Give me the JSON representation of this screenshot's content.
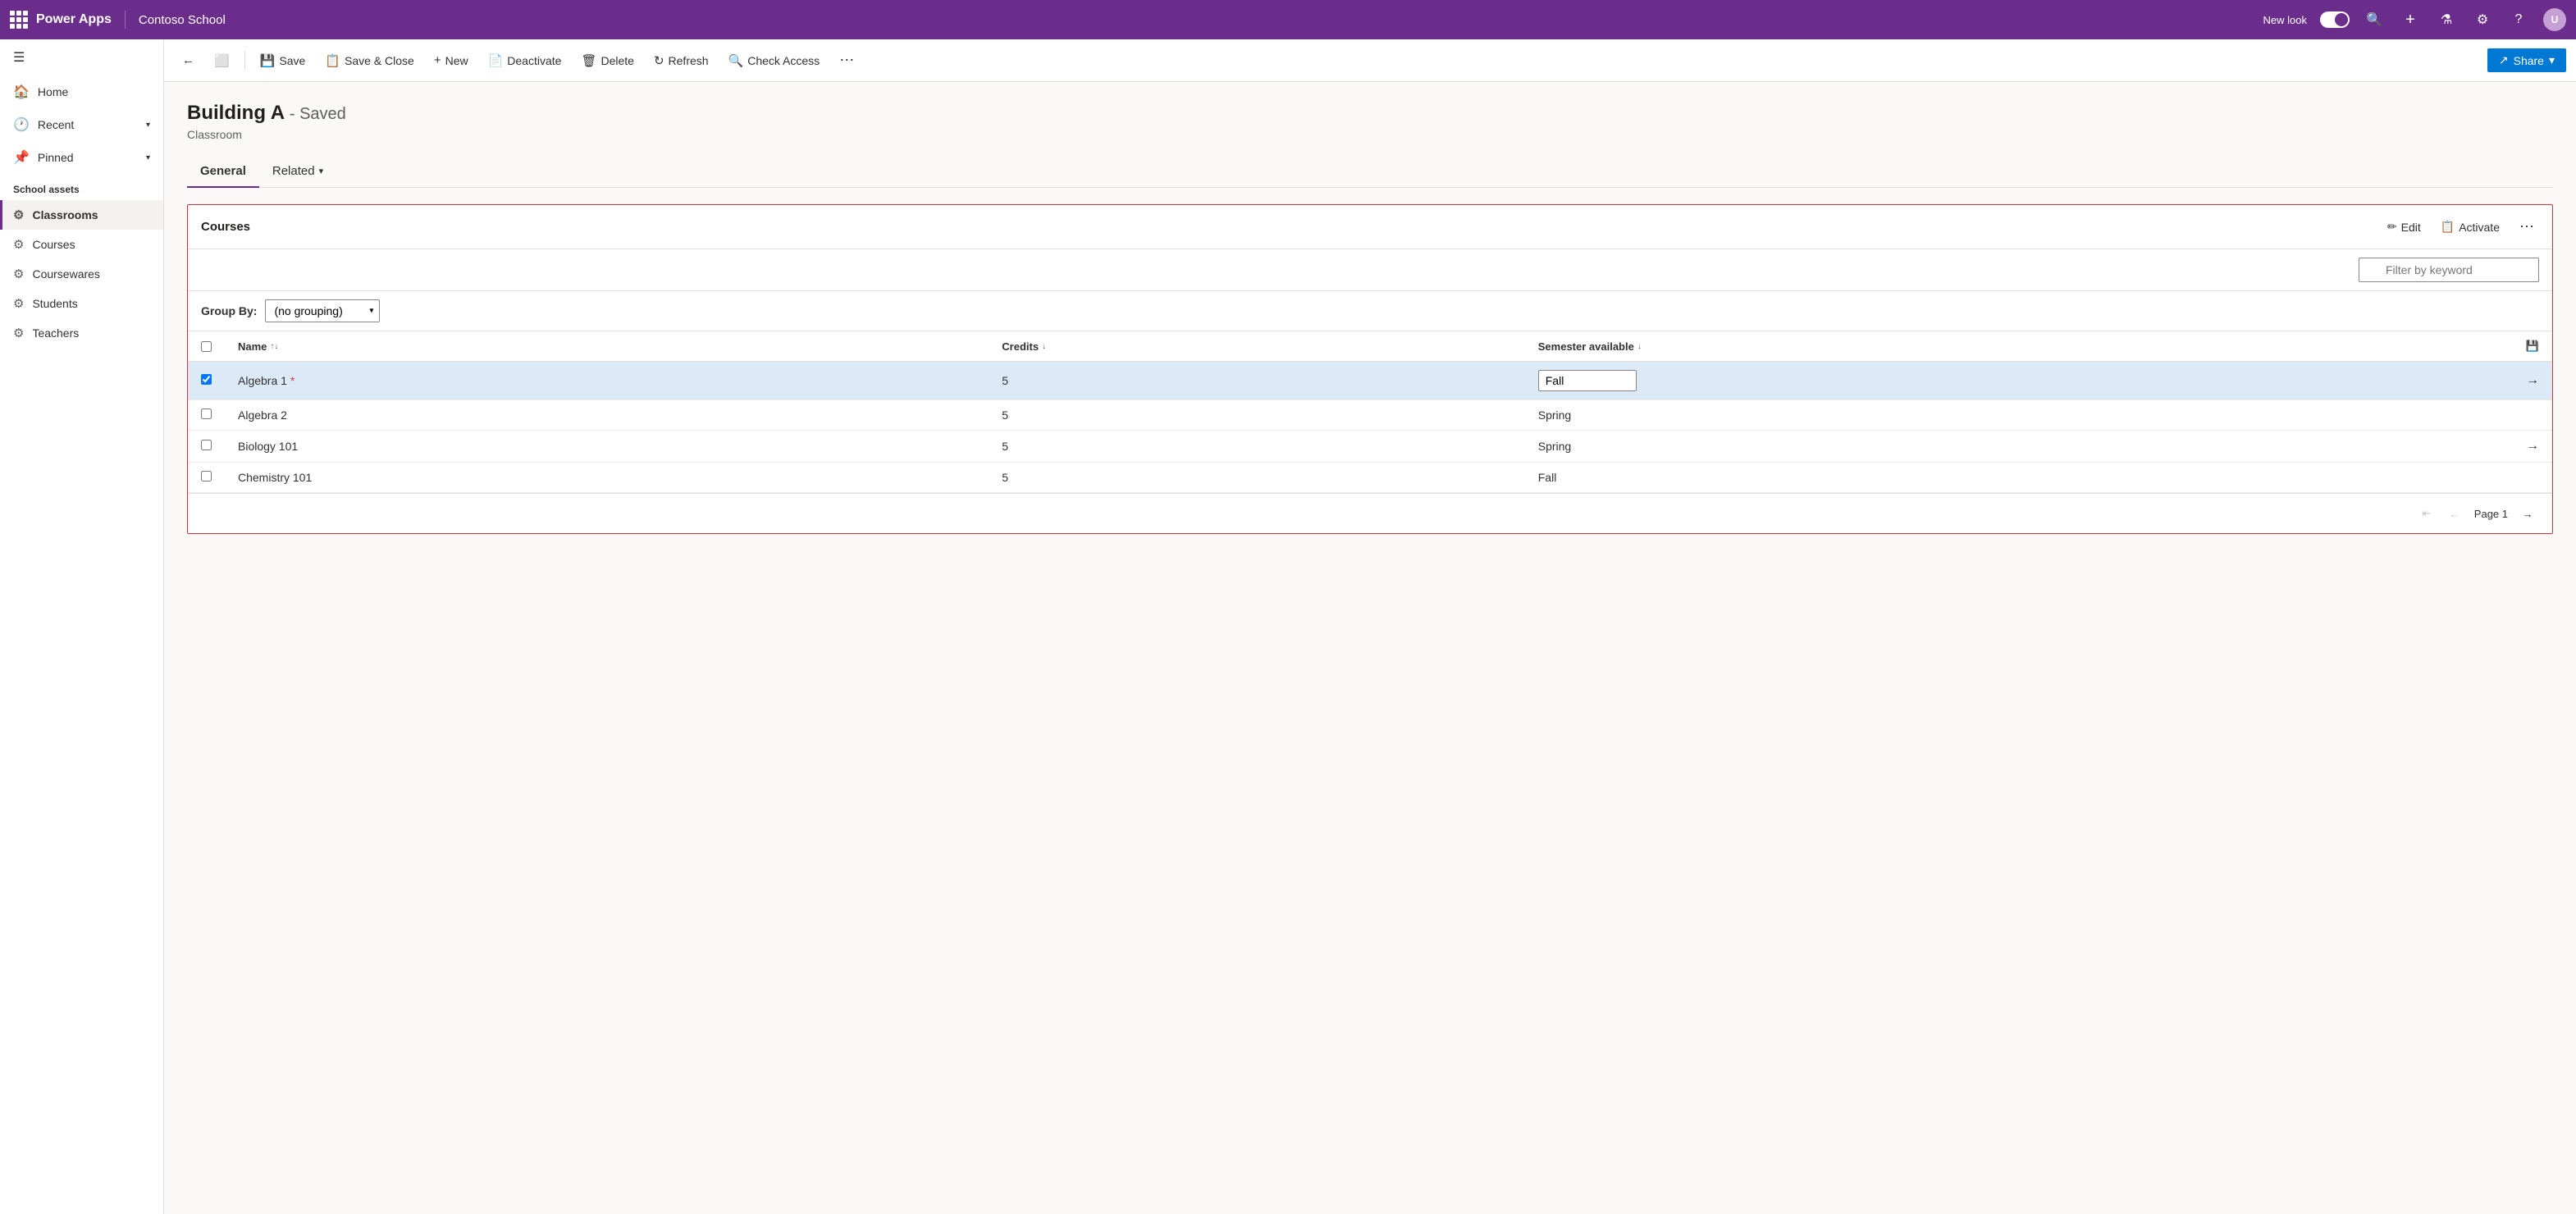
{
  "app": {
    "brand": "Power Apps",
    "app_name": "Contoso School",
    "new_look_label": "New look"
  },
  "toolbar": {
    "back_label": "←",
    "restore_label": "⬛",
    "save_label": "Save",
    "save_close_label": "Save & Close",
    "new_label": "New",
    "deactivate_label": "Deactivate",
    "delete_label": "Delete",
    "refresh_label": "Refresh",
    "check_access_label": "Check Access",
    "more_label": "...",
    "share_label": "Share"
  },
  "sidebar": {
    "hamburger": "☰",
    "nav_items": [
      {
        "icon": "🏠",
        "label": "Home"
      },
      {
        "icon": "🕐",
        "label": "Recent",
        "has_chevron": true
      },
      {
        "icon": "📌",
        "label": "Pinned",
        "has_chevron": true
      }
    ],
    "section_label": "School assets",
    "section_items": [
      {
        "icon": "⚙",
        "label": "Classrooms",
        "active": true
      },
      {
        "icon": "⚙",
        "label": "Courses"
      },
      {
        "icon": "⚙",
        "label": "Coursewares"
      },
      {
        "icon": "⚙",
        "label": "Students"
      },
      {
        "icon": "⚙",
        "label": "Teachers"
      }
    ]
  },
  "record": {
    "title": "Building A",
    "saved_label": "- Saved",
    "subtitle": "Classroom"
  },
  "tabs": [
    {
      "label": "General",
      "active": true
    },
    {
      "label": "Related",
      "has_chevron": true
    }
  ],
  "section": {
    "title": "Courses",
    "edit_label": "Edit",
    "activate_label": "Activate",
    "filter_placeholder": "Filter by keyword"
  },
  "group_by": {
    "label": "Group By:",
    "value": "(no grouping)"
  },
  "table": {
    "columns": [
      {
        "label": "Name",
        "sort": "↑↓"
      },
      {
        "label": "Credits",
        "sort": "↓"
      },
      {
        "label": "Semester available",
        "sort": "↓"
      }
    ],
    "rows": [
      {
        "name": "Algebra 1",
        "credits": "5",
        "semester": "Fall",
        "selected": true,
        "checked": true,
        "has_required": true,
        "show_arrow": true,
        "semester_input": true
      },
      {
        "name": "Algebra 2",
        "credits": "5",
        "semester": "Spring",
        "selected": false,
        "checked": false,
        "has_required": false,
        "show_arrow": false
      },
      {
        "name": "Biology 101",
        "credits": "5",
        "semester": "Spring",
        "selected": false,
        "checked": false,
        "has_required": false,
        "show_arrow": true
      },
      {
        "name": "Chemistry 101",
        "credits": "5",
        "semester": "Fall",
        "selected": false,
        "checked": false,
        "has_required": false,
        "show_arrow": false
      }
    ]
  },
  "pagination": {
    "page_label": "Page 1",
    "prev_disabled": true,
    "next_disabled": false
  }
}
